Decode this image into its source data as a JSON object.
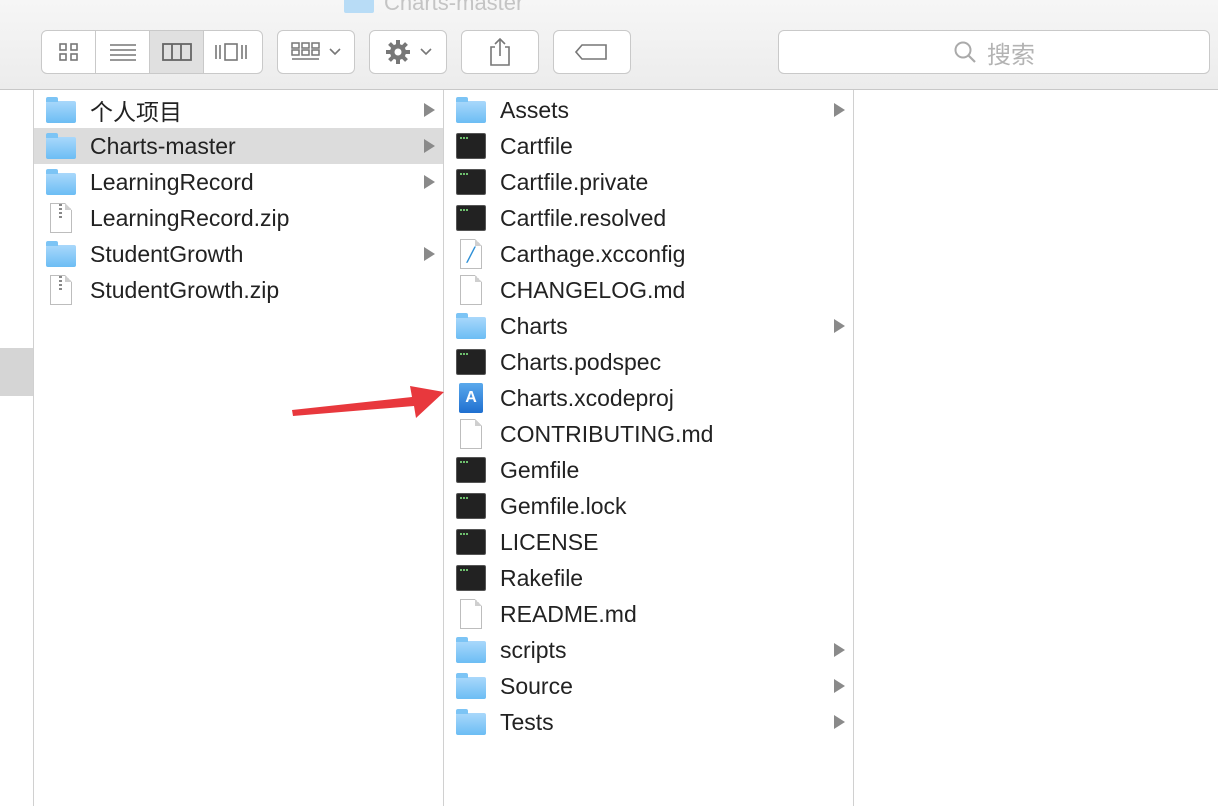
{
  "window": {
    "title": "Charts-master"
  },
  "toolbar": {
    "search_placeholder": "搜索",
    "view_modes": [
      "icon-view",
      "list-view",
      "column-view",
      "cover-flow-view"
    ],
    "active_view": "column-view"
  },
  "columns": [
    {
      "items": [
        {
          "label": "个人项目",
          "kind": "folder",
          "has_children": true,
          "selected": false
        },
        {
          "label": "Charts-master",
          "kind": "folder",
          "has_children": true,
          "selected": true
        },
        {
          "label": "LearningRecord",
          "kind": "folder",
          "has_children": true,
          "selected": false
        },
        {
          "label": "LearningRecord.zip",
          "kind": "zip",
          "has_children": false,
          "selected": false
        },
        {
          "label": "StudentGrowth",
          "kind": "folder",
          "has_children": true,
          "selected": false
        },
        {
          "label": "StudentGrowth.zip",
          "kind": "zip",
          "has_children": false,
          "selected": false
        }
      ]
    },
    {
      "items": [
        {
          "label": "Assets",
          "kind": "folder",
          "has_children": true
        },
        {
          "label": "Cartfile",
          "kind": "exec",
          "has_children": false
        },
        {
          "label": "Cartfile.private",
          "kind": "exec",
          "has_children": false
        },
        {
          "label": "Cartfile.resolved",
          "kind": "exec",
          "has_children": false
        },
        {
          "label": "Carthage.xcconfig",
          "kind": "xcconfig",
          "has_children": false
        },
        {
          "label": "CHANGELOG.md",
          "kind": "doc",
          "has_children": false
        },
        {
          "label": "Charts",
          "kind": "folder",
          "has_children": true
        },
        {
          "label": "Charts.podspec",
          "kind": "exec",
          "has_children": false
        },
        {
          "label": "Charts.xcodeproj",
          "kind": "xcodeproj",
          "has_children": false
        },
        {
          "label": "CONTRIBUTING.md",
          "kind": "doc",
          "has_children": false
        },
        {
          "label": "Gemfile",
          "kind": "exec",
          "has_children": false
        },
        {
          "label": "Gemfile.lock",
          "kind": "exec",
          "has_children": false
        },
        {
          "label": "LICENSE",
          "kind": "exec",
          "has_children": false
        },
        {
          "label": "Rakefile",
          "kind": "exec",
          "has_children": false
        },
        {
          "label": "README.md",
          "kind": "doc",
          "has_children": false
        },
        {
          "label": "scripts",
          "kind": "folder",
          "has_children": true
        },
        {
          "label": "Source",
          "kind": "folder",
          "has_children": true
        },
        {
          "label": "Tests",
          "kind": "folder",
          "has_children": true
        }
      ]
    }
  ],
  "annotation": {
    "color": "#e8383d"
  },
  "colors": {
    "selection": "#dcdcdc",
    "folder": "#6cbdf4",
    "arrow": "#e8383d"
  }
}
